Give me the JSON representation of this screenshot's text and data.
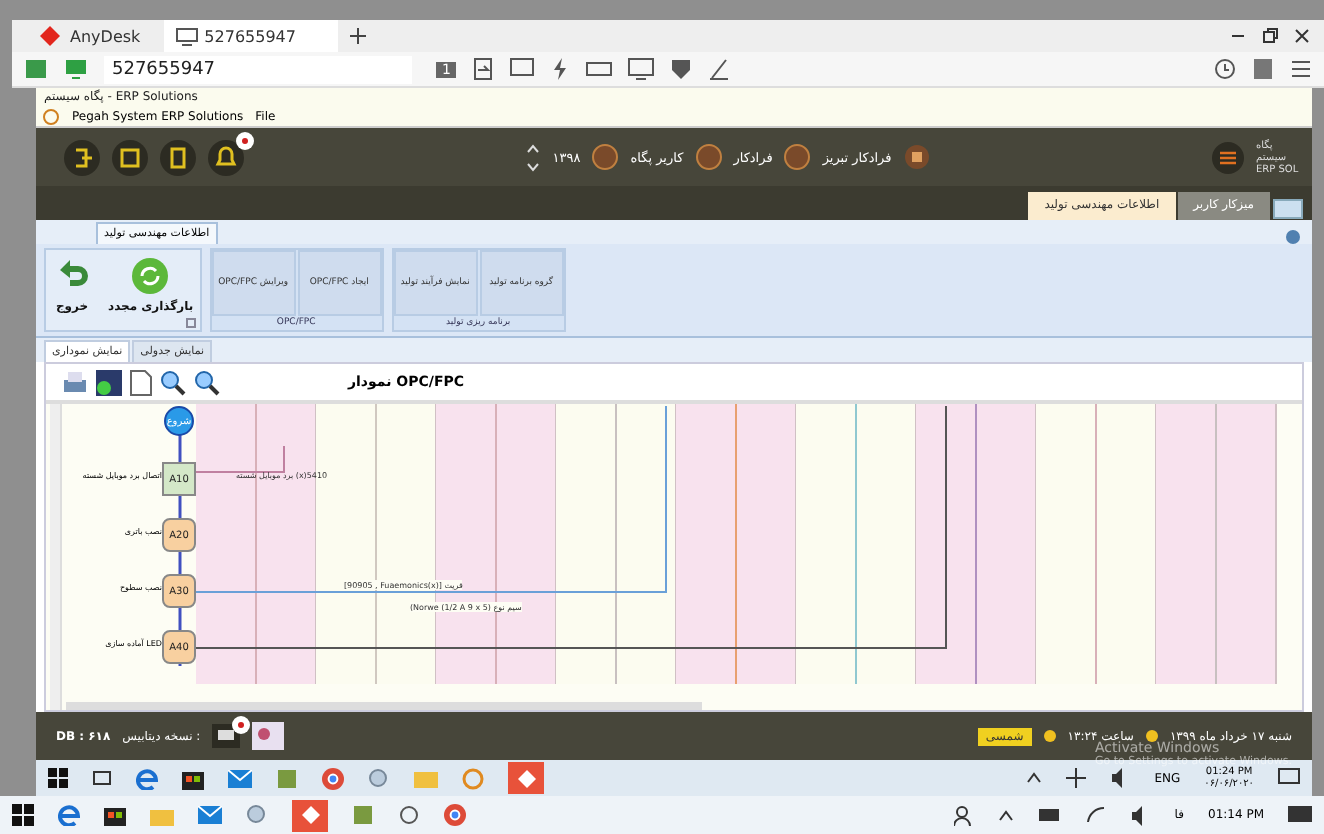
{
  "anydesk": {
    "home_tab": {
      "label": "AnyDesk",
      "selected": false
    },
    "session_tab": {
      "label": "527655947",
      "selected": true
    },
    "address": "527655947",
    "page_number": "1"
  },
  "erp": {
    "title": "پگاه سیستم - ERP Solutions",
    "menu": {
      "app": "Pegah System ERP Solutions",
      "file": "File"
    },
    "header": {
      "year": "۱۳۹۸",
      "companies": [
        "فرادکار تبریز",
        "فرادکار",
        "کاریر پگاه"
      ],
      "logo": "پگاه سیستم",
      "logo_sub": "ERP SOL"
    },
    "module_tabs": [
      {
        "label": "میزکار کاربر",
        "selected": false
      },
      {
        "label": "اطلاعات مهندسی تولید",
        "selected": true
      }
    ],
    "ribbon": {
      "tab": "اطلاعات مهندسی تولید",
      "groups": [
        {
          "label": "برنامه ریزی تولید",
          "buttons": [
            "گروه برنامه تولید",
            "نمایش فرآیند تولید"
          ]
        },
        {
          "label": "OPC/FPC",
          "buttons": [
            "ایجاد OPC/FPC",
            "ویرایش OPC/FPC"
          ]
        }
      ],
      "big_buttons": [
        {
          "kind": "reload",
          "label": "بارگذاری مجدد"
        },
        {
          "kind": "exit",
          "label": "خروج"
        }
      ]
    },
    "view_tabs": [
      {
        "label": "نمایش جدولی",
        "selected": false
      },
      {
        "label": "نمایش نموداری",
        "selected": true
      }
    ],
    "chart": {
      "title": "نمودار OPC/FPC",
      "nodes": [
        {
          "kind": "start",
          "code": "شروع"
        },
        {
          "kind": "done",
          "code": "A10",
          "label": "اتصال برد موبایل شسته"
        },
        {
          "kind": "pending",
          "code": "A20",
          "label": "نصب باتری"
        },
        {
          "kind": "pending",
          "code": "A30",
          "label": "نصب سطوح"
        },
        {
          "kind": "pending",
          "code": "A40",
          "label": "آماده سازی LED"
        }
      ],
      "edge_labels": [
        "برد موبایل شسته (x)5410",
        "[90905 , Fuaemonics(x)]  قریت",
        "(Norwe (1/2 A 9 x 5) سیم نوع"
      ]
    },
    "status_bar": {
      "db_label": "نسخه دیتابیس :",
      "db_version": "DB : ۶۱۸",
      "calendar": "شمسی",
      "time": "ساعت ۱۳:۲۴",
      "date": "شنبه ۱۷ خرداد ماه ۱۳۹۹"
    }
  },
  "activation": {
    "title": "Activate Windows",
    "subtitle": "Go to Settings to activate Windows."
  },
  "inner_taskbar": {
    "language": "ENG",
    "time": "01:24 PM",
    "date": "۰۶/۰۶/۲۰۲۰"
  },
  "outer_taskbar": {
    "language": "فا",
    "time": "01:14 PM"
  }
}
